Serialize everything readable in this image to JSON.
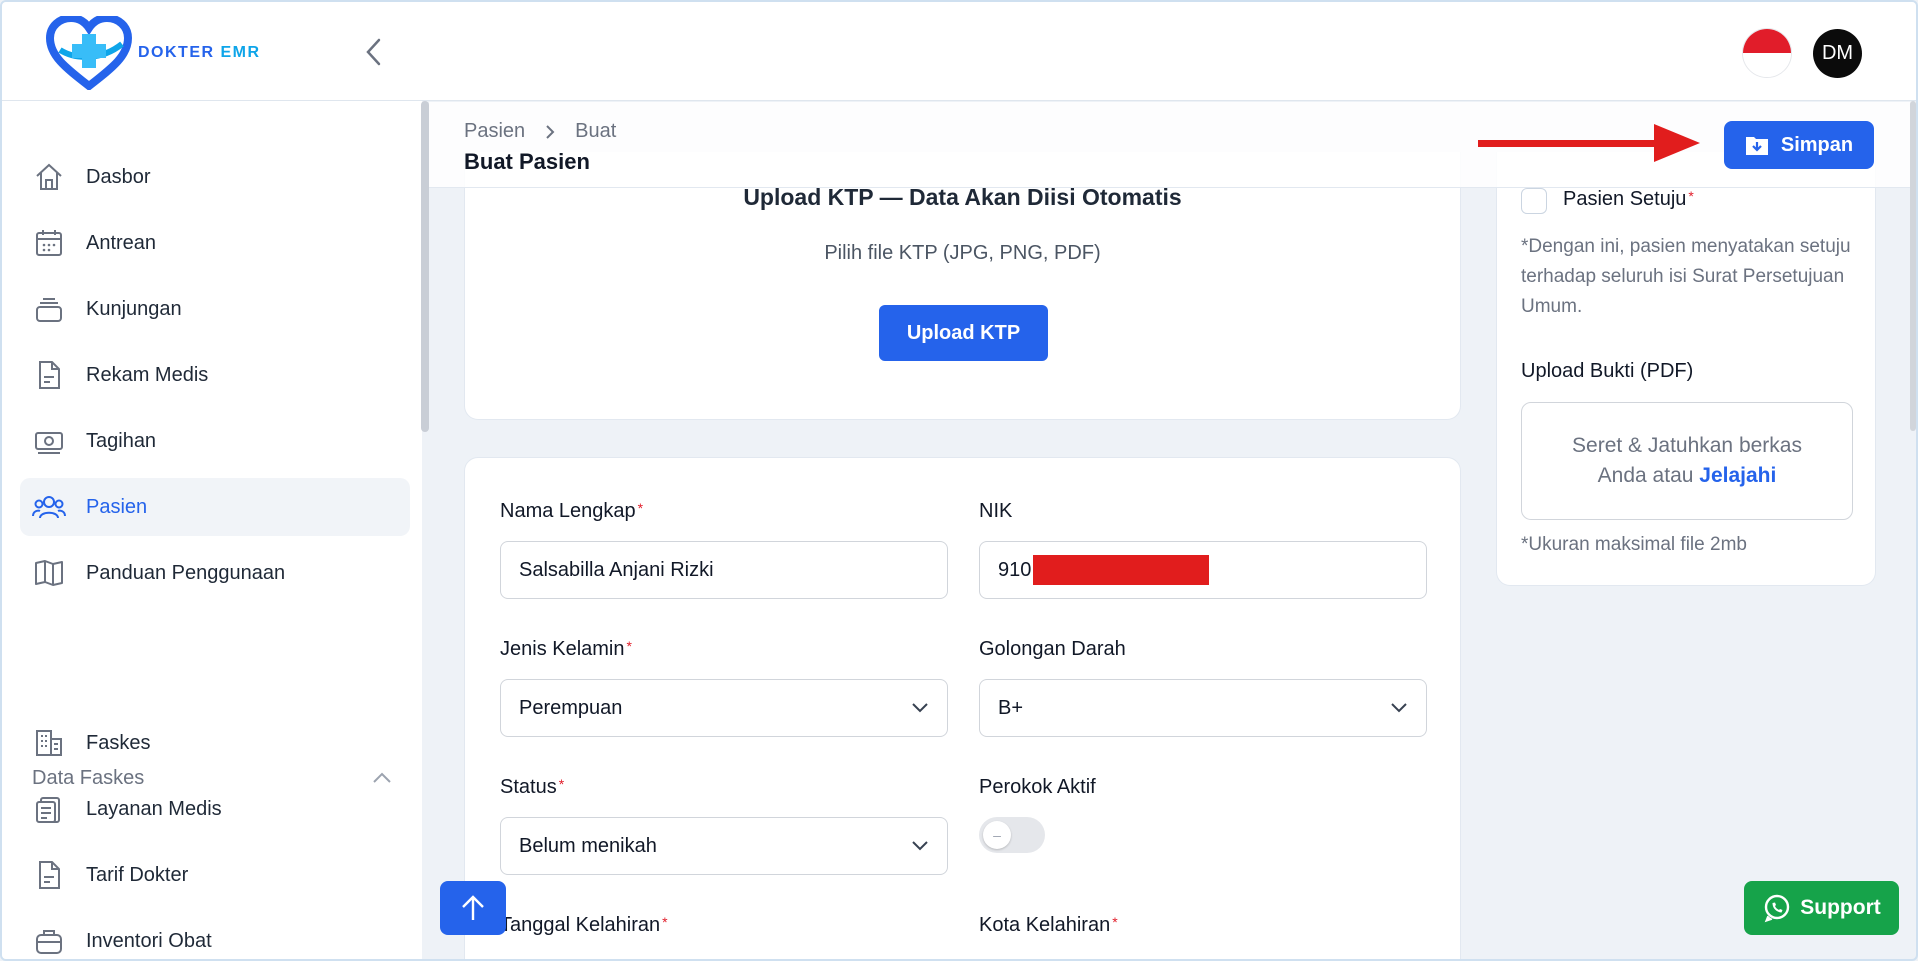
{
  "brand": {
    "name_part1": "DOKTER ",
    "name_part2": "EMR"
  },
  "header": {
    "language": "Indonesia",
    "avatar_initials": "DM"
  },
  "sidebar": {
    "items": [
      {
        "label": "Dasbor",
        "icon": "home-icon"
      },
      {
        "label": "Antrean",
        "icon": "calendar-icon"
      },
      {
        "label": "Kunjungan",
        "icon": "stack-icon"
      },
      {
        "label": "Rekam Medis",
        "icon": "document-icon"
      },
      {
        "label": "Tagihan",
        "icon": "money-icon"
      },
      {
        "label": "Pasien",
        "icon": "users-icon",
        "active": true
      },
      {
        "label": "Panduan Penggunaan",
        "icon": "book-icon"
      }
    ],
    "section_title": "Data Faskes",
    "section_items": [
      {
        "label": "Faskes",
        "icon": "building-icon"
      },
      {
        "label": "Layanan Medis",
        "icon": "clipboard-icon"
      },
      {
        "label": "Tarif Dokter",
        "icon": "document-icon"
      },
      {
        "label": "Inventori Obat",
        "icon": "case-icon"
      }
    ]
  },
  "breadcrumb": {
    "items": [
      "Pasien",
      "Buat"
    ]
  },
  "page_title": "Buat Pasien",
  "save_label": "Simpan",
  "upload": {
    "title": "Upload KTP — Data Akan Diisi Otomatis",
    "subtitle": "Pilih file KTP (JPG, PNG, PDF)",
    "button": "Upload KTP"
  },
  "form": {
    "full_name": {
      "label": "Nama Lengkap",
      "value": "Salsabilla Anjani Rizki"
    },
    "nik": {
      "label": "NIK",
      "value": "910"
    },
    "gender": {
      "label": "Jenis Kelamin",
      "value": "Perempuan"
    },
    "blood_type": {
      "label": "Golongan Darah",
      "value": "B+"
    },
    "status": {
      "label": "Status",
      "value": "Belum menikah"
    },
    "smoker": {
      "label": "Perokok Aktif",
      "checked": false
    },
    "birth_date": {
      "label": "Tanggal Kelahiran"
    },
    "birth_city": {
      "label": "Kota Kelahiran"
    }
  },
  "consent": {
    "checkbox_label": "Pasien Setuju",
    "text": "*Dengan ini, pasien menyatakan setuju terhadap seluruh isi Surat Persetujuan Umum.",
    "proof_label": "Upload Bukti (PDF)",
    "drop_line1": "Seret & Jatuhkan berkas",
    "drop_line2_prefix": "Anda atau ",
    "drop_browse": "Jelajahi",
    "size_note": "*Ukuran maksimal file 2mb"
  },
  "support_label": "Support",
  "colors": {
    "primary": "#2563eb",
    "required": "#e11d2a",
    "support": "#16a34a",
    "arrow": "#e11d1d"
  }
}
